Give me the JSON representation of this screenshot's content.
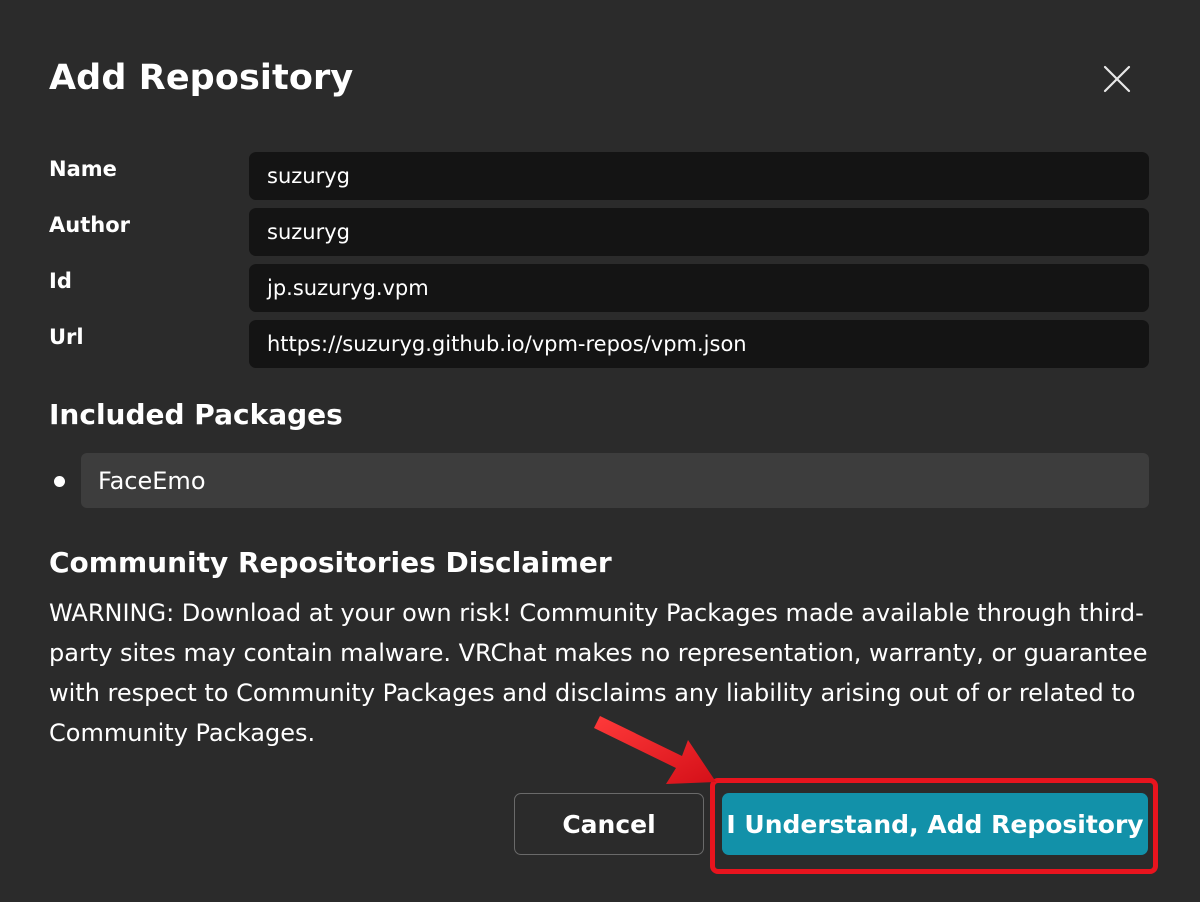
{
  "dialog": {
    "title": "Add Repository",
    "close_icon": "close-icon"
  },
  "fields": [
    {
      "label": "Name",
      "value": "suzuryg"
    },
    {
      "label": "Author",
      "value": "suzuryg"
    },
    {
      "label": "Id",
      "value": "jp.suzuryg.vpm"
    },
    {
      "label": "Url",
      "value": "https://suzuryg.github.io/vpm-repos/vpm.json"
    }
  ],
  "included_packages": {
    "heading": "Included Packages",
    "items": [
      "FaceEmo"
    ]
  },
  "disclaimer": {
    "heading": "Community Repositories Disclaimer",
    "text": "WARNING: Download at your own risk! Community Packages made available through third-party sites may contain malware. VRChat makes no representation, warranty, or guarantee with respect to Community Packages and disclaims any liability arising out of or related to Community Packages."
  },
  "buttons": {
    "cancel_label": "Cancel",
    "confirm_label": "I Understand, Add Repository"
  },
  "annotation": {
    "highlight_color": "#e8141e",
    "arrow_icon": "arrow-icon"
  },
  "colors": {
    "dialog_bg": "#2b2b2b",
    "field_bg": "#141414",
    "accent": "#1291a9"
  }
}
